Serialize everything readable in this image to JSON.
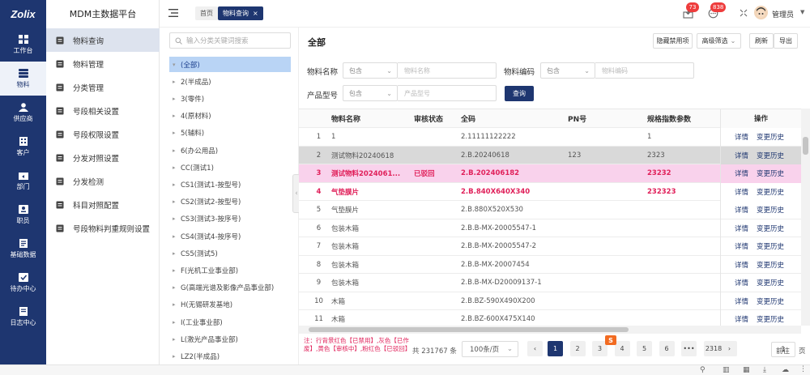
{
  "app": {
    "logo": "Zolix",
    "title": "MDM主数据平台"
  },
  "rail": [
    {
      "label": "工作台",
      "icon": "grid-icon"
    },
    {
      "label": "物料",
      "icon": "stack-icon",
      "active": true
    },
    {
      "label": "供应商",
      "icon": "person-icon"
    },
    {
      "label": "客户",
      "icon": "building-icon"
    },
    {
      "label": "部门",
      "icon": "share-box-icon"
    },
    {
      "label": "职员",
      "icon": "id-card-icon"
    },
    {
      "label": "基础数据",
      "icon": "form-icon"
    },
    {
      "label": "待办中心",
      "icon": "check-icon"
    },
    {
      "label": "日志中心",
      "icon": "log-icon"
    }
  ],
  "menu": [
    {
      "label": "物料查询",
      "active": true
    },
    {
      "label": "物料管理"
    },
    {
      "label": "分类管理"
    },
    {
      "label": "号段相关设置"
    },
    {
      "label": "号段权限设置"
    },
    {
      "label": "分发对照设置"
    },
    {
      "label": "分发检测"
    },
    {
      "label": "科目对照配置"
    },
    {
      "label": "号段物料判重规则设置"
    }
  ],
  "topbar": {
    "home_tab": "首页",
    "active_tab": "物料查询",
    "tab_close": "×",
    "badge_inbox": "73",
    "badge_msg": "838",
    "user": "管理员"
  },
  "tree": {
    "search_placeholder": "输入分类关键词搜索",
    "items": [
      {
        "label": "(全部)",
        "selected": true
      },
      {
        "label": "2(半成品)"
      },
      {
        "label": "3(零件)"
      },
      {
        "label": "4(原材料)"
      },
      {
        "label": "5(辅料)"
      },
      {
        "label": "6(办公用品)"
      },
      {
        "label": "CC(测试1)"
      },
      {
        "label": "CS1(测试1-按型号)"
      },
      {
        "label": "CS2(测试2-按型号)"
      },
      {
        "label": "CS3(测试3-按序号)"
      },
      {
        "label": "CS4(测试4-按序号)"
      },
      {
        "label": "CS5(测试5)"
      },
      {
        "label": "F(光机工业事业部)"
      },
      {
        "label": "G(高端光谱及影像产品事业部)"
      },
      {
        "label": "H(无锡研发基地)"
      },
      {
        "label": "I(工业事业部)"
      },
      {
        "label": "L(激光产品事业部)"
      },
      {
        "label": "LZ2(半成品)"
      }
    ]
  },
  "main": {
    "heading": "全部",
    "buttons": {
      "hide_disabled": "隐藏禁用项",
      "advanced": "高级筛选",
      "refresh": "刷新",
      "export": "导出"
    },
    "filters": {
      "name_label": "物料名称",
      "name_op": "包含",
      "name_placeholder": "物料名称",
      "code_label": "物料编码",
      "code_op": "包含",
      "code_placeholder": "物料编码",
      "model_label": "产品型号",
      "model_op": "包含",
      "model_placeholder": "产品型号",
      "query": "查询"
    },
    "columns": [
      "物料名称",
      "审核状态",
      "全码",
      "PN号",
      "规格指数参数",
      "操作"
    ],
    "rows": [
      {
        "no": "1",
        "name": "1",
        "status": "",
        "code": "2.11111122222",
        "pn": "",
        "spec": "1",
        "style": ""
      },
      {
        "no": "2",
        "name": "测试物料20240618",
        "status": "",
        "code": "2.B.20240618",
        "pn": "123",
        "spec": "2323",
        "style": "gray"
      },
      {
        "no": "3",
        "name": "测试物料2024061...",
        "status": "已驳回",
        "code": "2.B.202406182",
        "pn": "",
        "spec": "23232",
        "style": "pink"
      },
      {
        "no": "4",
        "name": "气垫膜片",
        "status": "",
        "code": "2.B.840X640X340",
        "pn": "",
        "spec": "232323",
        "style": "pink2"
      },
      {
        "no": "5",
        "name": "气垫膜片",
        "status": "",
        "code": "2.B.880X520X530",
        "pn": "",
        "spec": "",
        "style": ""
      },
      {
        "no": "6",
        "name": "包装木箱",
        "status": "",
        "code": "2.B.B-MX-20005547-1",
        "pn": "",
        "spec": "",
        "style": ""
      },
      {
        "no": "7",
        "name": "包装木箱",
        "status": "",
        "code": "2.B.B-MX-20005547-2",
        "pn": "",
        "spec": "",
        "style": ""
      },
      {
        "no": "8",
        "name": "包装木箱",
        "status": "",
        "code": "2.B.B-MX-20007454",
        "pn": "",
        "spec": "",
        "style": ""
      },
      {
        "no": "9",
        "name": "包装木箱",
        "status": "",
        "code": "2.B.B-MX-D20009137-1",
        "pn": "",
        "spec": "",
        "style": ""
      },
      {
        "no": "10",
        "name": "木箱",
        "status": "",
        "code": "2.B.BZ-590X490X200",
        "pn": "",
        "spec": "",
        "style": ""
      },
      {
        "no": "11",
        "name": "木箱",
        "status": "",
        "code": "2.B.BZ-600X475X140",
        "pn": "",
        "spec": "",
        "style": ""
      }
    ],
    "op_detail": "详情",
    "op_history": "变更历史",
    "ops_header": "操作"
  },
  "footer": {
    "note": "注：行背景红色【已禁用】,灰色【已作废】,黄色【审核中】,粉红色【已驳回】",
    "total": "共 231767 条",
    "page_size": "100条/页",
    "pages": [
      "1",
      "2",
      "3",
      "4",
      "5",
      "6",
      "•••",
      "2318"
    ],
    "prev": "‹",
    "next": "›",
    "goto_label": "前往",
    "goto_value": "1",
    "goto_unit": "页"
  },
  "colors": {
    "brand": "#1e3670",
    "pink_row": "#f9d2ec",
    "alert": "#e0205a"
  }
}
